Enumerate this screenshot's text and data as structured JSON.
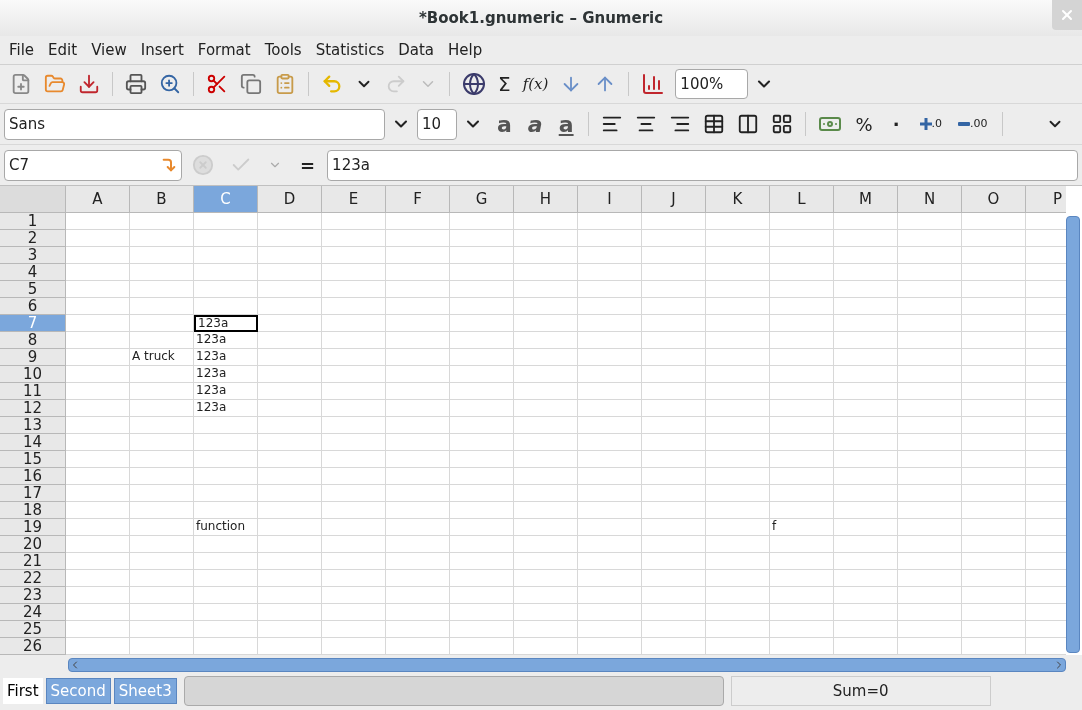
{
  "window": {
    "title": "*Book1.gnumeric – Gnumeric"
  },
  "menu": [
    "File",
    "Edit",
    "View",
    "Insert",
    "Format",
    "Tools",
    "Statistics",
    "Data",
    "Help"
  ],
  "toolbar": {
    "sum": "Σ",
    "function": "f(x)",
    "zoom": "100%"
  },
  "format_bar": {
    "font": "Sans",
    "size": "10",
    "bold": "a",
    "italic": "a",
    "underline": "a",
    "percent": "%",
    "thousands": "·",
    "add_decimal": ".0",
    "remove_decimal": ".00"
  },
  "entry": {
    "cell_ref": "C7",
    "equals": "=",
    "value": "123a"
  },
  "sheet": {
    "columns": [
      {
        "label": "A",
        "selected": false
      },
      {
        "label": "B",
        "selected": false
      },
      {
        "label": "C",
        "selected": true
      },
      {
        "label": "D",
        "selected": false
      },
      {
        "label": "E",
        "selected": false
      },
      {
        "label": "F",
        "selected": false
      },
      {
        "label": "G",
        "selected": false
      },
      {
        "label": "H",
        "selected": false
      },
      {
        "label": "I",
        "selected": false
      },
      {
        "label": "J",
        "selected": false
      },
      {
        "label": "K",
        "selected": false
      },
      {
        "label": "L",
        "selected": false
      },
      {
        "label": "M",
        "selected": false
      },
      {
        "label": "N",
        "selected": false
      },
      {
        "label": "O",
        "selected": false
      },
      {
        "label": "P",
        "selected": false
      }
    ],
    "rows": [
      {
        "label": "1",
        "selected": false,
        "cells": []
      },
      {
        "label": "2",
        "selected": false,
        "cells": []
      },
      {
        "label": "3",
        "selected": false,
        "cells": []
      },
      {
        "label": "4",
        "selected": false,
        "cells": []
      },
      {
        "label": "5",
        "selected": false,
        "cells": []
      },
      {
        "label": "6",
        "selected": false,
        "cells": []
      },
      {
        "label": "7",
        "selected": true,
        "cells": [
          "",
          "",
          "123a"
        ]
      },
      {
        "label": "8",
        "selected": false,
        "cells": [
          "",
          "",
          "123a"
        ]
      },
      {
        "label": "9",
        "selected": false,
        "cells": [
          "",
          "A truck",
          "123a"
        ]
      },
      {
        "label": "10",
        "selected": false,
        "cells": [
          "",
          "",
          "123a"
        ]
      },
      {
        "label": "11",
        "selected": false,
        "cells": [
          "",
          "",
          "123a"
        ]
      },
      {
        "label": "12",
        "selected": false,
        "cells": [
          "",
          "",
          "123a"
        ]
      },
      {
        "label": "13",
        "selected": false,
        "cells": []
      },
      {
        "label": "14",
        "selected": false,
        "cells": []
      },
      {
        "label": "15",
        "selected": false,
        "cells": []
      },
      {
        "label": "16",
        "selected": false,
        "cells": []
      },
      {
        "label": "17",
        "selected": false,
        "cells": []
      },
      {
        "label": "18",
        "selected": false,
        "cells": []
      },
      {
        "label": "19",
        "selected": false,
        "cells": [
          "",
          "",
          "function",
          "",
          "",
          "",
          "",
          "",
          "",
          "",
          "",
          "f"
        ]
      },
      {
        "label": "20",
        "selected": false,
        "cells": []
      },
      {
        "label": "21",
        "selected": false,
        "cells": []
      },
      {
        "label": "22",
        "selected": false,
        "cells": []
      },
      {
        "label": "23",
        "selected": false,
        "cells": []
      },
      {
        "label": "24",
        "selected": false,
        "cells": []
      },
      {
        "label": "25",
        "selected": false,
        "cells": []
      },
      {
        "label": "26",
        "selected": false,
        "cells": []
      }
    ]
  },
  "sheet_tabs": [
    {
      "label": "First",
      "selected": true
    },
    {
      "label": "Second",
      "selected": false
    },
    {
      "label": "Sheet3",
      "selected": false
    }
  ],
  "status": {
    "sum": "Sum=0"
  }
}
